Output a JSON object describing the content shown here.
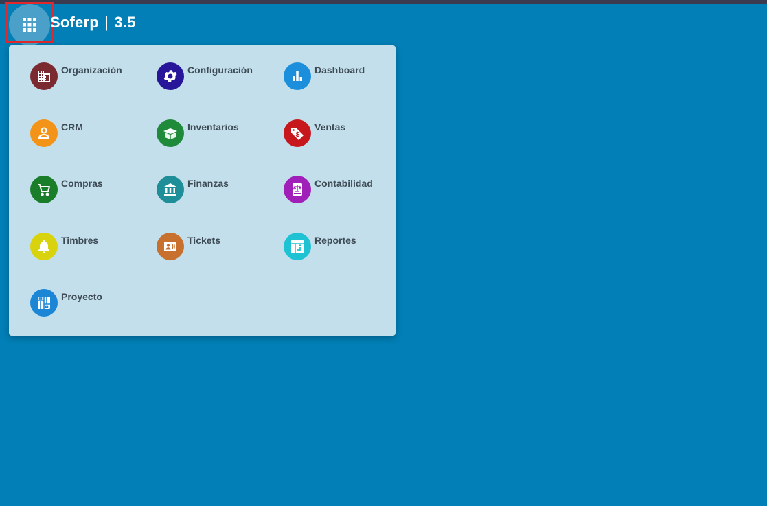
{
  "header": {
    "app_name": "Soferp",
    "separator": "|",
    "version": "3.5",
    "launcher_icon": "apps-grid-icon"
  },
  "menu": {
    "items": [
      {
        "label": "Organización",
        "icon": "building-icon",
        "color": "#7b2a2f"
      },
      {
        "label": "Configuración",
        "icon": "gear-icon",
        "color": "#27159a"
      },
      {
        "label": "Dashboard",
        "icon": "bar-chart-icon",
        "color": "#1b8fdc"
      },
      {
        "label": "CRM",
        "icon": "person-icon",
        "color": "#f39318"
      },
      {
        "label": "Inventarios",
        "icon": "box-icon",
        "color": "#1e8a3a"
      },
      {
        "label": "Ventas",
        "icon": "price-tag-icon",
        "color": "#c8161d"
      },
      {
        "label": "Compras",
        "icon": "cart-icon",
        "color": "#1a7d2a"
      },
      {
        "label": "Finanzas",
        "icon": "bank-icon",
        "color": "#1e8e98"
      },
      {
        "label": "Contabilidad",
        "icon": "ledger-scale-icon",
        "color": "#a01fb9"
      },
      {
        "label": "Timbres",
        "icon": "bell-icon",
        "color": "#d9d30e"
      },
      {
        "label": "Tickets",
        "icon": "contact-card-icon",
        "color": "#c8702e"
      },
      {
        "label": "Reportes",
        "icon": "report-arrows-icon",
        "color": "#1fc2d3"
      },
      {
        "label": "Proyecto",
        "icon": "project-board-icon",
        "color": "#1b86d6"
      }
    ]
  }
}
